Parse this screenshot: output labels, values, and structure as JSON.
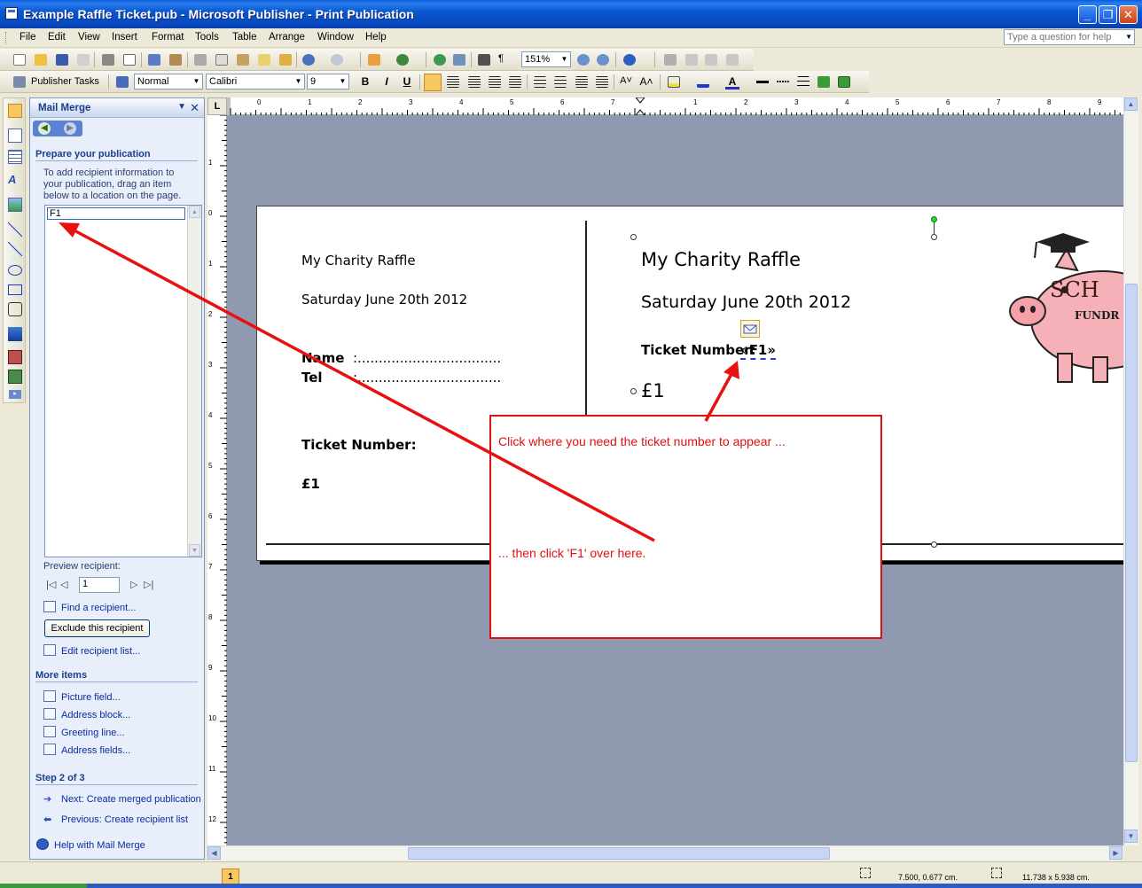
{
  "window": {
    "title": "Example Raffle Ticket.pub - Microsoft Publisher - Print Publication",
    "controls": [
      "minimize",
      "restore",
      "close"
    ]
  },
  "menu": {
    "items": [
      "File",
      "Edit",
      "View",
      "Insert",
      "Format",
      "Tools",
      "Table",
      "Arrange",
      "Window",
      "Help"
    ],
    "help_placeholder": "Type a question for help"
  },
  "toolbar": {
    "zoom": "151%",
    "publisher_tasks": "Publisher Tasks",
    "style": "Normal",
    "font": "Calibri",
    "font_size": "9"
  },
  "task_pane": {
    "title": "Mail Merge",
    "section_title": "Prepare your publication",
    "instructions": "To add recipient information to your publication, drag an item below to a location on the page.",
    "fields": [
      "F1"
    ],
    "preview_label": "Preview recipient:",
    "preview_value": "1",
    "find_recipient": "Find a recipient...",
    "exclude_button": "Exclude this recipient",
    "edit_list": "Edit recipient list...",
    "more_items_title": "More items",
    "more_items": [
      "Picture field...",
      "Address block...",
      "Greeting line...",
      "Address fields..."
    ],
    "step_title": "Step 2 of 3",
    "next_link": "Next: Create merged publication",
    "previous_link": "Previous: Create recipient list",
    "help_link": "Help with Mail Merge"
  },
  "rulers": {
    "horizontal_left": [
      "0",
      "1",
      "2",
      "3",
      "4",
      "5",
      "6",
      "7"
    ],
    "horizontal_right": [
      "1",
      "2",
      "3",
      "4",
      "5",
      "6",
      "7",
      "8",
      "9"
    ],
    "vertical": [
      "1",
      "0",
      "1",
      "2",
      "3",
      "4",
      "5",
      "6",
      "7",
      "8",
      "9",
      "10",
      "11",
      "12"
    ]
  },
  "ticket": {
    "stub": {
      "title": "My Charity Raffle",
      "date": "Saturday June 20th 2012",
      "name_label": "Name",
      "tel_label": "Tel",
      "dots": ":..................................",
      "number_label": "Ticket Number:",
      "price": "£1"
    },
    "main": {
      "title": "My Charity Raffle",
      "date": "Saturday June 20th 2012",
      "number_label": "Ticket Number:",
      "merge_field": "«F1»",
      "price": "£1"
    },
    "logo_text_1": "SCH",
    "logo_text_2": "FUNDR"
  },
  "callout": {
    "line1": "Click where you need the ticket number to appear ...",
    "line2": "... then click 'F1' over here.",
    "color": "#e01010"
  },
  "status": {
    "page_number": "1",
    "position": "7.500, 0.677 cm.",
    "size": "11.738 x   5.938 cm."
  }
}
